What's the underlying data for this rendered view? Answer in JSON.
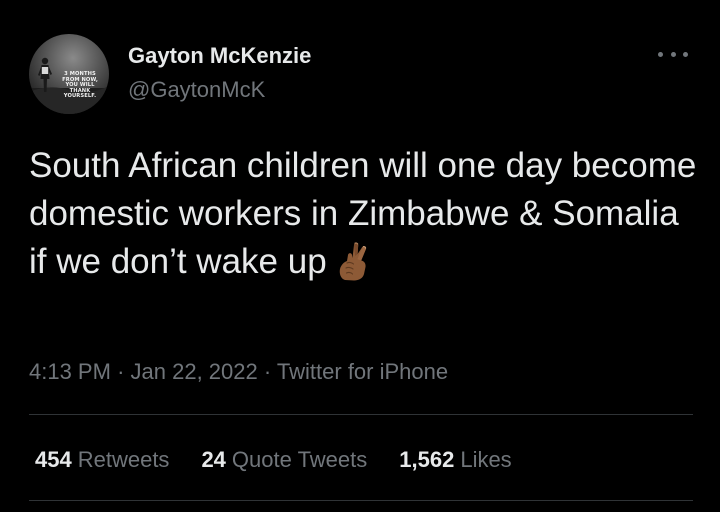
{
  "author": {
    "display_name": "Gayton McKenzie",
    "handle": "@GaytonMcK",
    "avatar_text": "3 MONTHS FROM NOW, YOU WILL THANK YOURSELF."
  },
  "tweet": {
    "text": "South African children will one day become domestic workers in Zimbabwe & Somalia if we don’t wake up",
    "emoji": "crossed-fingers-icon"
  },
  "meta": {
    "time": "4:13 PM",
    "separator": "·",
    "date": "Jan 22, 2022",
    "source": "Twitter for iPhone"
  },
  "stats": [
    {
      "count": "454",
      "label": "Retweets"
    },
    {
      "count": "24",
      "label": "Quote Tweets"
    },
    {
      "count": "1,562",
      "label": "Likes"
    }
  ],
  "colors": {
    "background": "#000000",
    "primary_text": "#e7e9ea",
    "secondary_text": "#71767b",
    "divider": "#2f3336"
  }
}
